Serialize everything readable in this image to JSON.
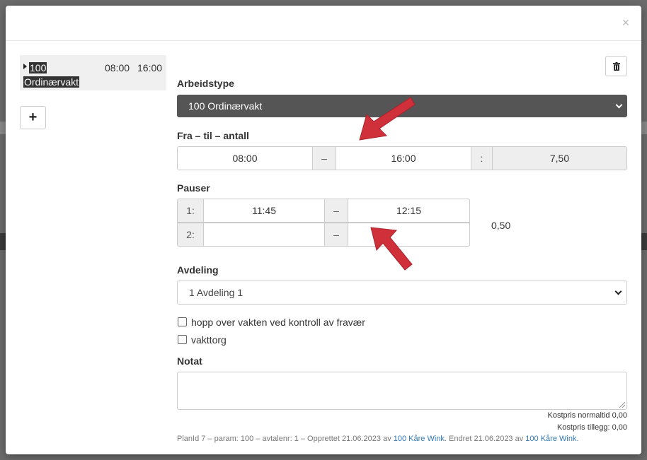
{
  "dialog": {
    "close_glyph": "×"
  },
  "shift_list": {
    "items": [
      {
        "name_line1": "100",
        "name_line2": "Ordinærvakt",
        "from": "08:00",
        "to": "16:00"
      }
    ],
    "add_glyph": "+"
  },
  "form": {
    "worktype": {
      "label": "Arbeidstype",
      "value": "100 Ordinærvakt"
    },
    "time": {
      "label": "Fra – til – antall",
      "from": "08:00",
      "dash": "–",
      "to": "16:00",
      "colon": ":",
      "count": "7,50"
    },
    "pauses": {
      "label": "Pauser",
      "rows": [
        {
          "index": "1:",
          "from": "11:45",
          "dash": "–",
          "to": "12:15"
        },
        {
          "index": "2:",
          "from": "",
          "dash": "–",
          "to": ""
        }
      ],
      "total": "0,50"
    },
    "department": {
      "label": "Avdeling",
      "value": "1 Avdeling 1"
    },
    "checkboxes": [
      {
        "label": "hopp over vakten ved kontroll av fravær",
        "checked": false
      },
      {
        "label": "vakttorg",
        "checked": false
      }
    ],
    "note": {
      "label": "Notat",
      "value": ""
    }
  },
  "costs": {
    "normal": "Kostpris normaltid 0,00",
    "extra": "Kostpris tillegg: 0,00"
  },
  "footer": {
    "prefix": "PlanId 7 – param: 100 – avtalenr: 1 – Opprettet 21.06.2023 av ",
    "created_by": "100 Kåre Wink",
    "middle": ". Endret 21.06.2023 av ",
    "changed_by": "100 Kåre Wink",
    "suffix": "."
  },
  "colors": {
    "select_dark_bg": "#555555",
    "link": "#337ab7",
    "arrow": "#d0303a"
  }
}
